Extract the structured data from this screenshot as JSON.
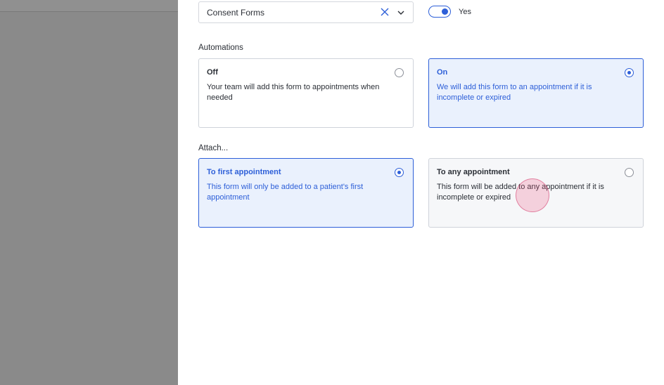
{
  "form_type": {
    "selected": "Consent Forms"
  },
  "toggle": {
    "label": "Yes",
    "on": true
  },
  "automations": {
    "label": "Automations",
    "options": [
      {
        "title": "Off",
        "description": "Your team will add this form to appointments when needed",
        "selected": false
      },
      {
        "title": "On",
        "description": "We will add this form to an appointment if it is incomplete or expired",
        "selected": true
      }
    ]
  },
  "attach": {
    "label": "Attach...",
    "options": [
      {
        "title": "To first appointment",
        "description": "This form will only be added to a patient's first appointment",
        "selected": true
      },
      {
        "title": "To any appointment",
        "description": "This form will be added to any appointment if it is incomplete or expired",
        "selected": false
      }
    ]
  },
  "colors": {
    "accent": "#2d5fd8",
    "selected_bg": "#eaf1fd",
    "overlay": "#8a8a8a",
    "cursor": "#ec4878"
  }
}
